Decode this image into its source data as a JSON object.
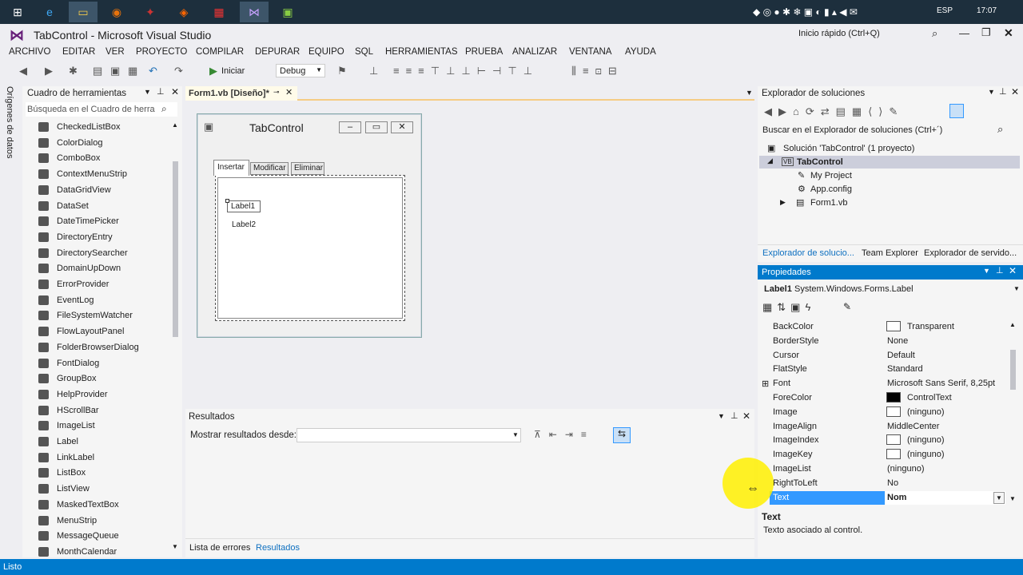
{
  "taskbar": {
    "tray": [
      "ESP",
      "17:07"
    ]
  },
  "window": {
    "title": "TabControl - Microsoft Visual Studio",
    "quick_launch": "Inicio rápido (Ctrl+Q)"
  },
  "menu": [
    "ARCHIVO",
    "EDITAR",
    "VER",
    "PROYECTO",
    "COMPILAR",
    "DEPURAR",
    "EQUIPO",
    "SQL",
    "HERRAMIENTAS",
    "PRUEBA",
    "ANALIZAR",
    "VENTANA",
    "AYUDA"
  ],
  "toolbar": {
    "start": "Iniciar",
    "config": "Debug"
  },
  "side_strip": "Orígenes de datos",
  "toolbox": {
    "title": "Cuadro de herramientas",
    "search": "Búsqueda en el Cuadro de herra",
    "items": [
      "CheckedListBox",
      "ColorDialog",
      "ComboBox",
      "ContextMenuStrip",
      "DataGridView",
      "DataSet",
      "DateTimePicker",
      "DirectoryEntry",
      "DirectorySearcher",
      "DomainUpDown",
      "ErrorProvider",
      "EventLog",
      "FileSystemWatcher",
      "FlowLayoutPanel",
      "FolderBrowserDialog",
      "FontDialog",
      "GroupBox",
      "HelpProvider",
      "HScrollBar",
      "ImageList",
      "Label",
      "LinkLabel",
      "ListBox",
      "ListView",
      "MaskedTextBox",
      "MenuStrip",
      "MessageQueue",
      "MonthCalendar"
    ]
  },
  "document_tab": "Form1.vb [Diseño]*",
  "form": {
    "title": "TabControl",
    "tabs": [
      "Insertar",
      "Modificar",
      "Eliminar"
    ],
    "label1": "Label1",
    "label2": "Label2"
  },
  "results": {
    "title": "Resultados",
    "show_from": "Mostrar resultados desde:",
    "bottom_tabs": [
      "Lista de errores",
      "Resultados"
    ]
  },
  "solution_explorer": {
    "title": "Explorador de soluciones",
    "search": "Buscar en el Explorador de soluciones (Ctrl+´)",
    "solution": "Solución 'TabControl' (1 proyecto)",
    "project": "TabControl",
    "nodes": [
      "My Project",
      "App.config",
      "Form1.vb"
    ],
    "bottom_tabs": [
      "Explorador de solucio...",
      "Team Explorer",
      "Explorador de servido..."
    ]
  },
  "properties": {
    "title": "Propiedades",
    "object": "Label1",
    "object_type": "System.Windows.Forms.Label",
    "rows": [
      {
        "name": "BackColor",
        "value": "Transparent",
        "swatch": "#ffffff"
      },
      {
        "name": "BorderStyle",
        "value": "None"
      },
      {
        "name": "Cursor",
        "value": "Default"
      },
      {
        "name": "FlatStyle",
        "value": "Standard"
      },
      {
        "name": "Font",
        "value": "Microsoft Sans Serif, 8,25pt"
      },
      {
        "name": "ForeColor",
        "value": "ControlText",
        "swatch": "#000000"
      },
      {
        "name": "Image",
        "value": "(ninguno)",
        "swatch": "#ffffff"
      },
      {
        "name": "ImageAlign",
        "value": "MiddleCenter"
      },
      {
        "name": "ImageIndex",
        "value": "(ninguno)",
        "swatch": "#ffffff"
      },
      {
        "name": "ImageKey",
        "value": "(ninguno)",
        "swatch": "#ffffff"
      },
      {
        "name": "ImageList",
        "value": "(ninguno)"
      },
      {
        "name": "RightToLeft",
        "value": "No"
      },
      {
        "name": "Text",
        "value": "Nom"
      }
    ],
    "desc_title": "Text",
    "desc_text": "Texto asociado al control."
  },
  "status": "Listo",
  "colors": {
    "accent": "#007acc",
    "selection": "#3399ff"
  }
}
